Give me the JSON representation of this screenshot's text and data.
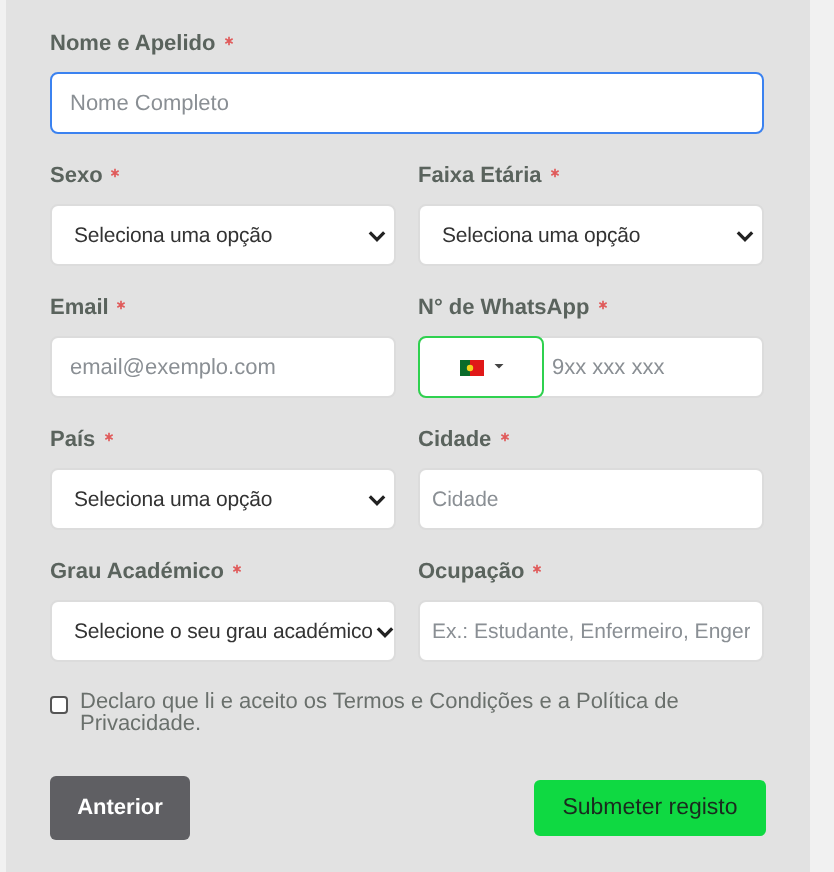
{
  "rows": [
    [
      {
        "kind": "text",
        "label": "Nome e Apelido",
        "required": true,
        "placeholder": "Nome Completo",
        "focused": true
      }
    ],
    [
      {
        "kind": "select",
        "label": "Sexo",
        "required": true,
        "value": "Seleciona uma opção"
      },
      {
        "kind": "select",
        "label": "Faixa Etária",
        "required": true,
        "value": "Seleciona uma opção"
      }
    ],
    [
      {
        "kind": "text",
        "label": "Email",
        "required": true,
        "placeholder": "email@exemplo.com",
        "focused": false
      },
      {
        "kind": "phone",
        "label": "N° de WhatsApp",
        "required": true,
        "placeholder": "9xx xxx xxx"
      }
    ],
    [
      {
        "kind": "select",
        "label": "País",
        "required": true,
        "value": "Seleciona uma opção"
      },
      {
        "kind": "text",
        "label": "Cidade",
        "required": true,
        "placeholder": "Cidade",
        "focused": false
      }
    ],
    [
      {
        "kind": "select",
        "label": "Grau Académico",
        "required": true,
        "value": "Selecione o seu grau académico"
      },
      {
        "kind": "text",
        "label": "Ocupação",
        "required": true,
        "placeholder": "Ex.: Estudante, Enfermeiro, Enger",
        "focused": false
      }
    ]
  ],
  "consent": {
    "checked": false,
    "text": "Declaro que li e aceito os Termos e Condições e a Política de Privacidade."
  },
  "buttons": [
    {
      "kind": "back",
      "label": "Anterior"
    },
    {
      "kind": "submit",
      "label": "Submeter registo"
    }
  ]
}
